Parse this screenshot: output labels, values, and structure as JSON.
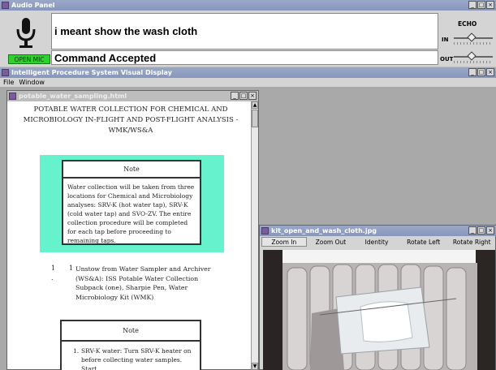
{
  "audio_panel": {
    "title": "Audio Panel",
    "heard_text": "i meant show the wash cloth",
    "status_text": "Command Accepted",
    "open_mic_label": "OPEN MIC",
    "echo_label": "ECHO",
    "in_label": "IN",
    "out_label": "OUT",
    "in_level": 0.45,
    "out_level": 0.45
  },
  "main_window": {
    "title": "Intelligent Procedure System Visual Display",
    "menu": [
      "File",
      "Window"
    ]
  },
  "doc_window": {
    "title": "potable_water_sampling.html",
    "heading": "POTABLE WATER COLLECTION FOR CHEMICAL AND MICROBIOLOGY IN-FLIGHT AND POST-FLIGHT ANALYSIS - WMK/WS&A",
    "note1_label": "Note",
    "note1_text": "Water collection will be taken from three locations for Chemical and Microbiology analyses: SRV-K (hot water tap), SRV-K (cold water tap) and SVO-ZV. The entire collection procedure will be completed for each tap before proceeding to remaining taps.",
    "step_number": "1",
    "step_sub": "1",
    "step_text": "Unstow from Water Sampler and Archiver (WS&A): ISS Potable Water Collection Subpack (one), Sharpie Pen, Water Microbiology Kit (WMK)",
    "note2_label": "Note",
    "note2_item": "1.",
    "note2_text": "SRV-K water: Turn SRV-K heater on before collecting water samples. Start"
  },
  "image_window": {
    "title": "kit_open_and_wash_cloth.jpg",
    "toolbar": [
      "Zoom In",
      "Zoom Out",
      "Identity",
      "Rotate Left",
      "Rotate Right"
    ]
  },
  "colors": {
    "accent_teal": "#66f2cc",
    "open_mic_green": "#2fd12f"
  }
}
